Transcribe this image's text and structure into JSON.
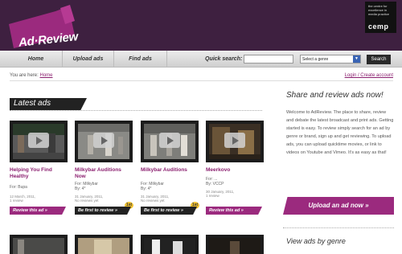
{
  "header": {
    "logo_text": "Ad·Review",
    "partner_tagline": "the centre for excellence in media practice",
    "partner_logo": "cemp",
    "colors": {
      "header_bg": "#3e2040",
      "accent": "#9b2a7e"
    }
  },
  "nav": {
    "items": [
      "Home",
      "Upload ads",
      "Find ads"
    ],
    "quick_search_label": "Quick search:",
    "quick_search_value": "",
    "genre_select": "Select a genre",
    "search_button": "Search"
  },
  "breadcrumb": {
    "prefix": "You are here:",
    "link": "Home"
  },
  "account_link": "Login / Create account",
  "latest": {
    "heading": "Latest ads",
    "cards": [
      {
        "title": "Helping You Find Healthy",
        "for": "For: Bupa",
        "by": "",
        "date": "12 March, 2011,",
        "reviews": "1 review",
        "button": "Review this ad »",
        "button_style": "pink",
        "badge": ""
      },
      {
        "title": "Milkybar Auditions Now",
        "for": "For: Milkybar",
        "by": "By: 4*",
        "date": "31 January, 2011,",
        "reviews": "No reviews yet",
        "button": "Be first to review »",
        "button_style": "dark",
        "badge": "1st"
      },
      {
        "title": "Milkybar Auditions",
        "for": "For: Milkybar",
        "by": "By: 4*",
        "date": "31 January, 2011,",
        "reviews": "No reviews yet",
        "button": "Be first to review »",
        "button_style": "dark",
        "badge": "1st"
      },
      {
        "title": "Meerkovo",
        "for": "For: ...",
        "by": "By: VCCP",
        "date": "30 January, 2011,",
        "reviews": "1 review",
        "button": "Review this ad »",
        "button_style": "pink",
        "badge": ""
      }
    ]
  },
  "sidebar": {
    "title": "Share and review ads now!",
    "text": "Welcome to AdReview. The place to share, review and debate the latest broadcast and print ads. Getting started is easy. To review simply search for an ad by genre or brand, sign up and get reviewing. To upload ads, you can upload quicktime movies, or link to videos on Youtube and Vimeo. It's as easy as that!",
    "upload_button": "Upload an ad now »",
    "genre_title": "View ads by genre"
  }
}
